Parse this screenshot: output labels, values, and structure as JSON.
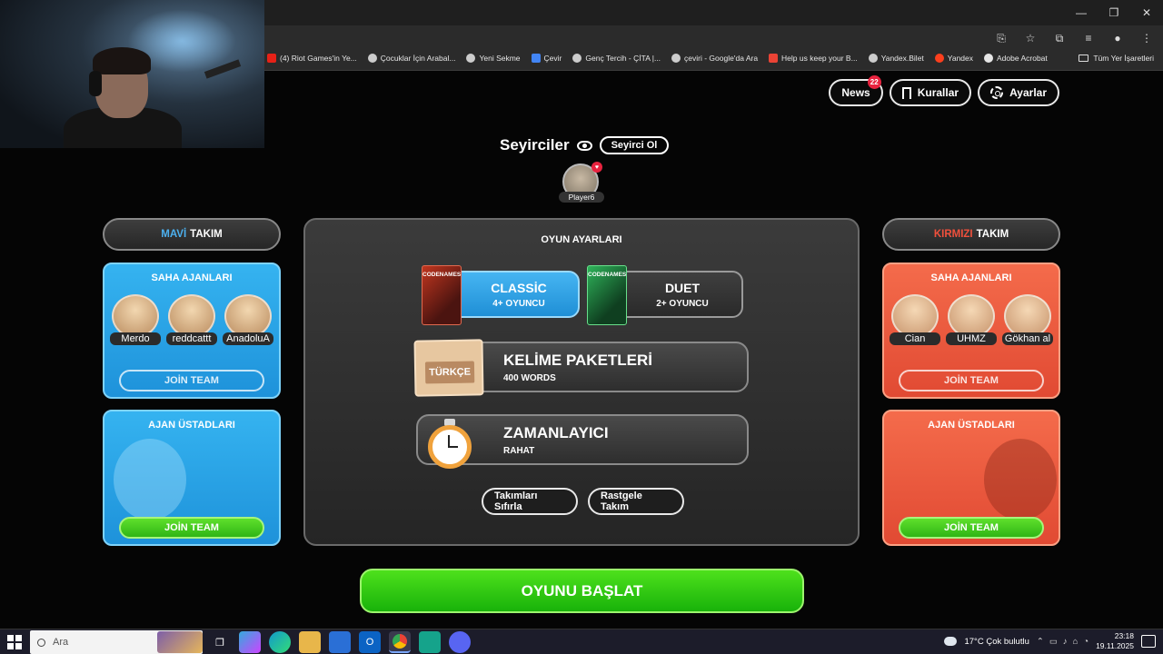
{
  "browser": {
    "bookmarks": [
      {
        "label": "(4) Riot Games'in Ye...",
        "icon": "youtube-icon"
      },
      {
        "label": "Çocuklar İçin Arabal...",
        "icon": "google-icon"
      },
      {
        "label": "Yeni Sekme",
        "icon": "globe-icon"
      },
      {
        "label": "Çevir",
        "icon": "translate-icon"
      },
      {
        "label": "Genç Tercih - ÇİTA |...",
        "icon": "google-icon"
      },
      {
        "label": "çeviri - Google'da Ara",
        "icon": "google-icon"
      },
      {
        "label": "Help us keep your B...",
        "icon": "gmail-icon"
      },
      {
        "label": "Yandex.Bilet",
        "icon": "globe-icon"
      },
      {
        "label": "Yandex",
        "icon": "yandex-icon"
      },
      {
        "label": "Adobe Acrobat",
        "icon": "acrobat-icon"
      }
    ],
    "all_bookmarks": "Tüm Yer İşaretleri"
  },
  "game": {
    "top": {
      "news_label": "News",
      "news_badge": "22",
      "rules_label": "Kurallar",
      "settings_label": "Ayarlar"
    },
    "spectators": {
      "title": "Seyirciler",
      "button": "Seyirci Ol",
      "player": "Player6"
    },
    "blue_team": {
      "name_color": "MAVİ",
      "name_rest": "TAKIM",
      "operatives_title": "SAHA AJANLARI",
      "operatives": [
        "Merdo",
        "reddcattt",
        "AnadoluA"
      ],
      "join_outline": "JOİN TEAM",
      "spymasters_title": "AJAN ÜSTADLARI",
      "join_green": "JOİN TEAM"
    },
    "red_team": {
      "name_color": "KIRMIZI",
      "name_rest": "TAKIM",
      "operatives_title": "SAHA AJANLARI",
      "operatives": [
        "Cian",
        "UHMZ",
        "Gökhan al"
      ],
      "join_outline": "JOİN TEAM",
      "spymasters_title": "AJAN ÜSTADLARI",
      "join_green": "JOİN TEAM"
    },
    "settings": {
      "title": "OYUN AYARLARI",
      "mode_classic": "CLASSİC",
      "mode_classic_sub": "4+ OYUNCU",
      "mode_duet": "DUET",
      "mode_duet_sub": "2+ OYUNCU",
      "box_text": "CODENAMES",
      "words_title": "KELİME PAKETLERİ",
      "words_sub": "400 WORDS",
      "words_tag": "TÜRKÇE",
      "timer_title": "ZAMANLAYICI",
      "timer_sub": "RAHAT",
      "reset_btn": "Takımları Sıfırla",
      "random_btn": "Rastgele Takım"
    },
    "start_button": "OYUNU BAŞLAT"
  },
  "taskbar": {
    "search_placeholder": "Ara",
    "weather": "17°C  Çok bulutlu",
    "time": "23:18",
    "date": "19.11.2025"
  },
  "colors": {
    "blue_team": "#35b3f0",
    "red_team": "#f46b4b",
    "start_green": "#2fc714",
    "badge_red": "#e8233f"
  }
}
